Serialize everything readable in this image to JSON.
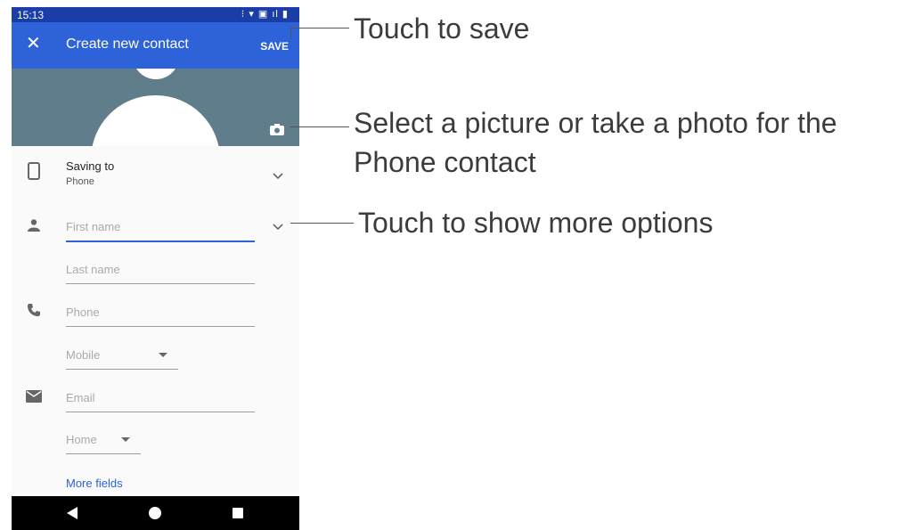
{
  "status": {
    "time": "15:13",
    "icons": "⁝ ▾ ▣ ıl ▮"
  },
  "appbar": {
    "close_label": "✕",
    "title": "Create new contact",
    "save_label": "SAVE"
  },
  "form": {
    "saving_to_label": "Saving to",
    "saving_to_value": "Phone",
    "first_name_placeholder": "First name",
    "last_name_placeholder": "Last name",
    "phone_placeholder": "Phone",
    "phone_type": "Mobile",
    "email_placeholder": "Email",
    "email_type": "Home",
    "more_fields": "More fields"
  },
  "annotations": {
    "save": "Touch to save",
    "photo": "Select a picture or take a photo for the Phone contact",
    "options": "Touch to show more options"
  },
  "colors": {
    "status_bar": "#1a3da8",
    "app_bar": "#2e62d8",
    "photo_bg": "#607d8b",
    "accent": "#2e62d8"
  }
}
